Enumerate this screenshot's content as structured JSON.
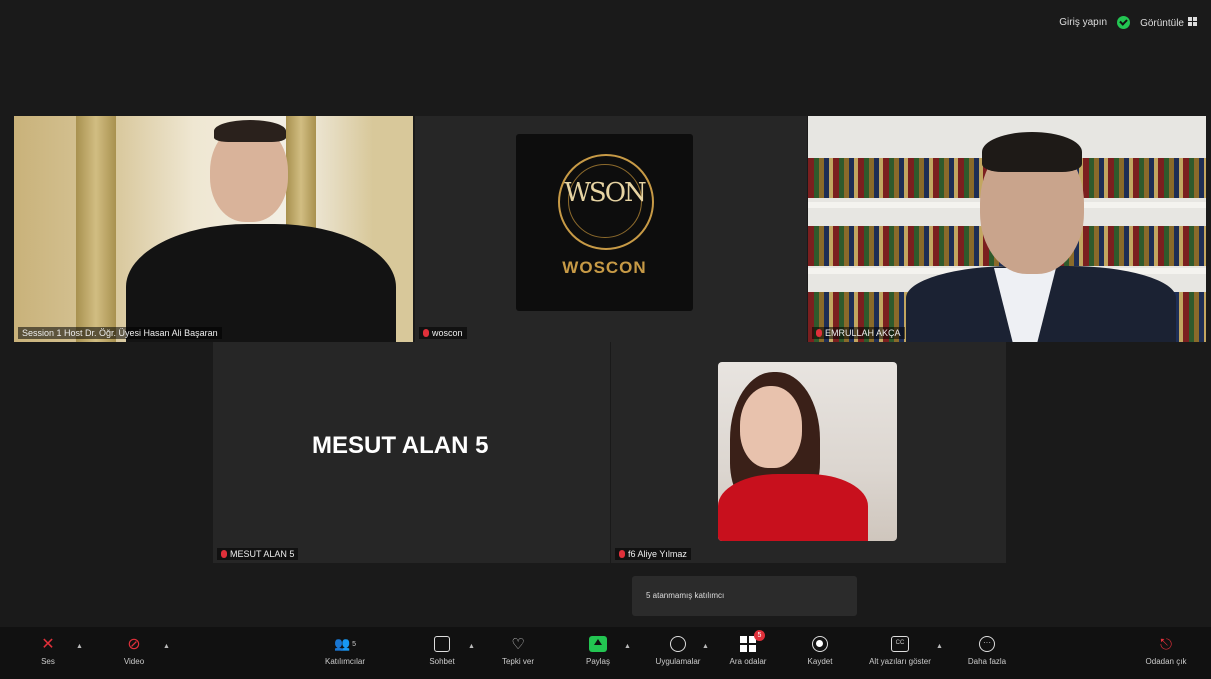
{
  "topbar": {
    "signin_label": "Giriş yapın",
    "view_label": "Görüntüle"
  },
  "tiles": {
    "t1_name": "Session 1 Host Dr. Öğr. Üyesi Hasan Ali Başaran",
    "t2_name": "woscon",
    "t3_name": "EMRULLAH AKÇA",
    "t4_name": "MESUT ALAN 5",
    "t4_big_name": "MESUT ALAN 5",
    "t5_name": "f6 Aliye Yılmaz"
  },
  "logo": {
    "text": "WOSCON",
    "mono": "WSON"
  },
  "popup": {
    "text": "5 atanmamış katılımcı"
  },
  "toolbar": {
    "audio": "Ses",
    "video": "Video",
    "participants": "Katılımcılar",
    "participants_count": "5",
    "chat": "Sohbet",
    "react": "Tepki ver",
    "share": "Paylaş",
    "apps": "Uygulamalar",
    "rooms": "Ara odalar",
    "rooms_badge": "5",
    "record": "Kaydet",
    "captions": "Alt yazıları göster",
    "more": "Daha fazla",
    "leave": "Odadan çık"
  },
  "colors": {
    "active_speaker": "#2bd26b",
    "muted": "#e0303a",
    "share": "#23c552",
    "logo_gold": "#c79a46"
  }
}
